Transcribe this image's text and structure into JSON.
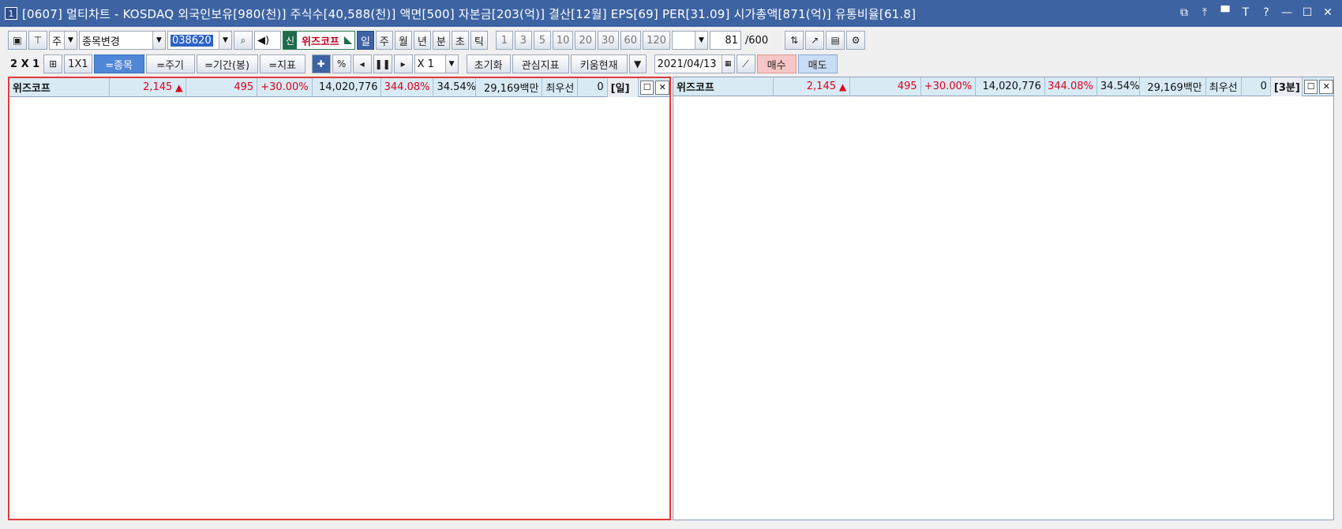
{
  "titlebar": {
    "window_num": "1",
    "title": "[0607] 멀티차트 - KOSDAQ 외국인보유[980(천)] 주식수[40,588(천)] 액면[500] 자본금[203(억)] 결산[12월] EPS[69] PER[31.09] 시가총액[871(억)] 유통비율[61.8]",
    "controls": [
      "⧉",
      "⤒",
      "▀",
      "T",
      "?",
      "—",
      "☐",
      "✕"
    ]
  },
  "toolbar1": {
    "market": "주",
    "mode": "종목변경",
    "code": "038620",
    "badge": "신",
    "stock_name": "위즈코프",
    "periods": [
      "일",
      "주",
      "월",
      "년",
      "분",
      "초",
      "틱"
    ],
    "active_period": "일",
    "intervals": [
      "1",
      "3",
      "5",
      "10",
      "20",
      "30",
      "60",
      "120"
    ],
    "count": "81",
    "count_max": "/600"
  },
  "toolbar2": {
    "grid_label": "2 X 1",
    "layout_1x1": "1X1",
    "btn_stock": "=종목",
    "btn_period": "=주기",
    "btn_range": "=기간(봉)",
    "btn_indicator": "=지표",
    "pct": "%",
    "scale": "X 1",
    "reset": "초기화",
    "fav_indicator": "관심지표",
    "kiwoom": "키움현재",
    "date": "2021/04/13",
    "buy": "매수",
    "sell": "매도"
  },
  "left_panel": {
    "header": {
      "name": "위즈코프",
      "price": "2,145",
      "change": "495",
      "change_pct": "+30.00%",
      "volume": "14,020,776",
      "vol_ratio": "344.08%",
      "turnover": "34.54%",
      "amount": "29,169백만",
      "best": "최우선",
      "best_val": "0",
      "period": "[일]"
    }
  },
  "right_panel": {
    "header": {
      "name": "위즈코프",
      "price": "2,145",
      "change": "495",
      "change_pct": "+30.00%",
      "volume": "14,020,776",
      "vol_ratio": "344.08%",
      "turnover": "34.54%",
      "amount": "29,169백만",
      "best": "최우선",
      "best_val": "0",
      "period": "[3분]"
    }
  }
}
